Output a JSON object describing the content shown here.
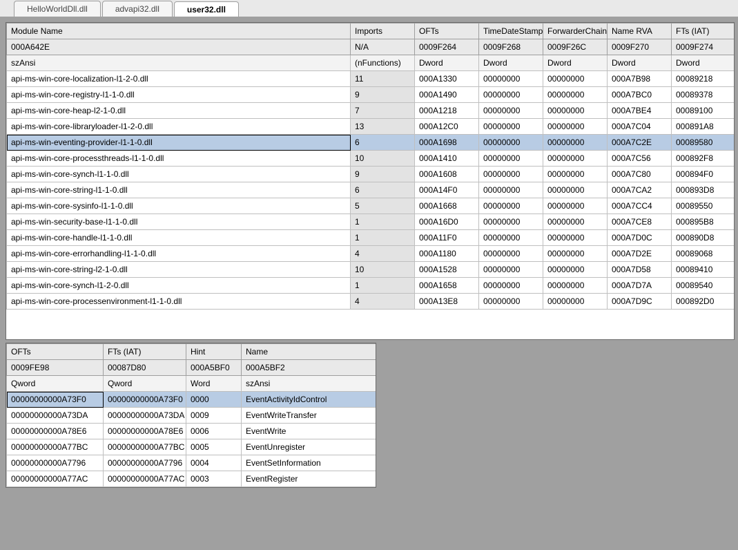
{
  "tabs": [
    {
      "label": "HelloWorldDll.dll",
      "active": false
    },
    {
      "label": "advapi32.dll",
      "active": false
    },
    {
      "label": "user32.dll",
      "active": true
    }
  ],
  "imports_grid": {
    "columns": [
      "Module Name",
      "Imports",
      "OFTs",
      "TimeDateStamp",
      "ForwarderChain",
      "Name RVA",
      "FTs (IAT)"
    ],
    "header_row": [
      "000A642E",
      "N/A",
      "0009F264",
      "0009F268",
      "0009F26C",
      "0009F270",
      "0009F274"
    ],
    "type_row": [
      "szAnsi",
      "(nFunctions)",
      "Dword",
      "Dword",
      "Dword",
      "Dword",
      "Dword"
    ],
    "selected_index": 4,
    "rows": [
      [
        "api-ms-win-core-localization-l1-2-0.dll",
        "11",
        "000A1330",
        "00000000",
        "00000000",
        "000A7B98",
        "00089218"
      ],
      [
        "api-ms-win-core-registry-l1-1-0.dll",
        "9",
        "000A1490",
        "00000000",
        "00000000",
        "000A7BC0",
        "00089378"
      ],
      [
        "api-ms-win-core-heap-l2-1-0.dll",
        "7",
        "000A1218",
        "00000000",
        "00000000",
        "000A7BE4",
        "00089100"
      ],
      [
        "api-ms-win-core-libraryloader-l1-2-0.dll",
        "13",
        "000A12C0",
        "00000000",
        "00000000",
        "000A7C04",
        "000891A8"
      ],
      [
        "api-ms-win-eventing-provider-l1-1-0.dll",
        "6",
        "000A1698",
        "00000000",
        "00000000",
        "000A7C2E",
        "00089580"
      ],
      [
        "api-ms-win-core-processthreads-l1-1-0.dll",
        "10",
        "000A1410",
        "00000000",
        "00000000",
        "000A7C56",
        "000892F8"
      ],
      [
        "api-ms-win-core-synch-l1-1-0.dll",
        "9",
        "000A1608",
        "00000000",
        "00000000",
        "000A7C80",
        "000894F0"
      ],
      [
        "api-ms-win-core-string-l1-1-0.dll",
        "6",
        "000A14F0",
        "00000000",
        "00000000",
        "000A7CA2",
        "000893D8"
      ],
      [
        "api-ms-win-core-sysinfo-l1-1-0.dll",
        "5",
        "000A1668",
        "00000000",
        "00000000",
        "000A7CC4",
        "00089550"
      ],
      [
        "api-ms-win-security-base-l1-1-0.dll",
        "1",
        "000A16D0",
        "00000000",
        "00000000",
        "000A7CE8",
        "000895B8"
      ],
      [
        "api-ms-win-core-handle-l1-1-0.dll",
        "1",
        "000A11F0",
        "00000000",
        "00000000",
        "000A7D0C",
        "000890D8"
      ],
      [
        "api-ms-win-core-errorhandling-l1-1-0.dll",
        "4",
        "000A1180",
        "00000000",
        "00000000",
        "000A7D2E",
        "00089068"
      ],
      [
        "api-ms-win-core-string-l2-1-0.dll",
        "10",
        "000A1528",
        "00000000",
        "00000000",
        "000A7D58",
        "00089410"
      ],
      [
        "api-ms-win-core-synch-l1-2-0.dll",
        "1",
        "000A1658",
        "00000000",
        "00000000",
        "000A7D7A",
        "00089540"
      ],
      [
        "api-ms-win-core-processenvironment-l1-1-0.dll",
        "4",
        "000A13E8",
        "00000000",
        "00000000",
        "000A7D9C",
        "000892D0"
      ]
    ]
  },
  "functions_grid": {
    "columns": [
      "OFTs",
      "FTs (IAT)",
      "Hint",
      "Name"
    ],
    "header_row": [
      "0009FE98",
      "00087D80",
      "000A5BF0",
      "000A5BF2"
    ],
    "type_row": [
      "Qword",
      "Qword",
      "Word",
      "szAnsi"
    ],
    "selected_index": 0,
    "rows": [
      [
        "00000000000A73F0",
        "00000000000A73F0",
        "0000",
        "EventActivityIdControl"
      ],
      [
        "00000000000A73DA",
        "00000000000A73DA",
        "0009",
        "EventWriteTransfer"
      ],
      [
        "00000000000A78E6",
        "00000000000A78E6",
        "0006",
        "EventWrite"
      ],
      [
        "00000000000A77BC",
        "00000000000A77BC",
        "0005",
        "EventUnregister"
      ],
      [
        "00000000000A7796",
        "00000000000A7796",
        "0004",
        "EventSetInformation"
      ],
      [
        "00000000000A77AC",
        "00000000000A77AC",
        "0003",
        "EventRegister"
      ]
    ]
  }
}
